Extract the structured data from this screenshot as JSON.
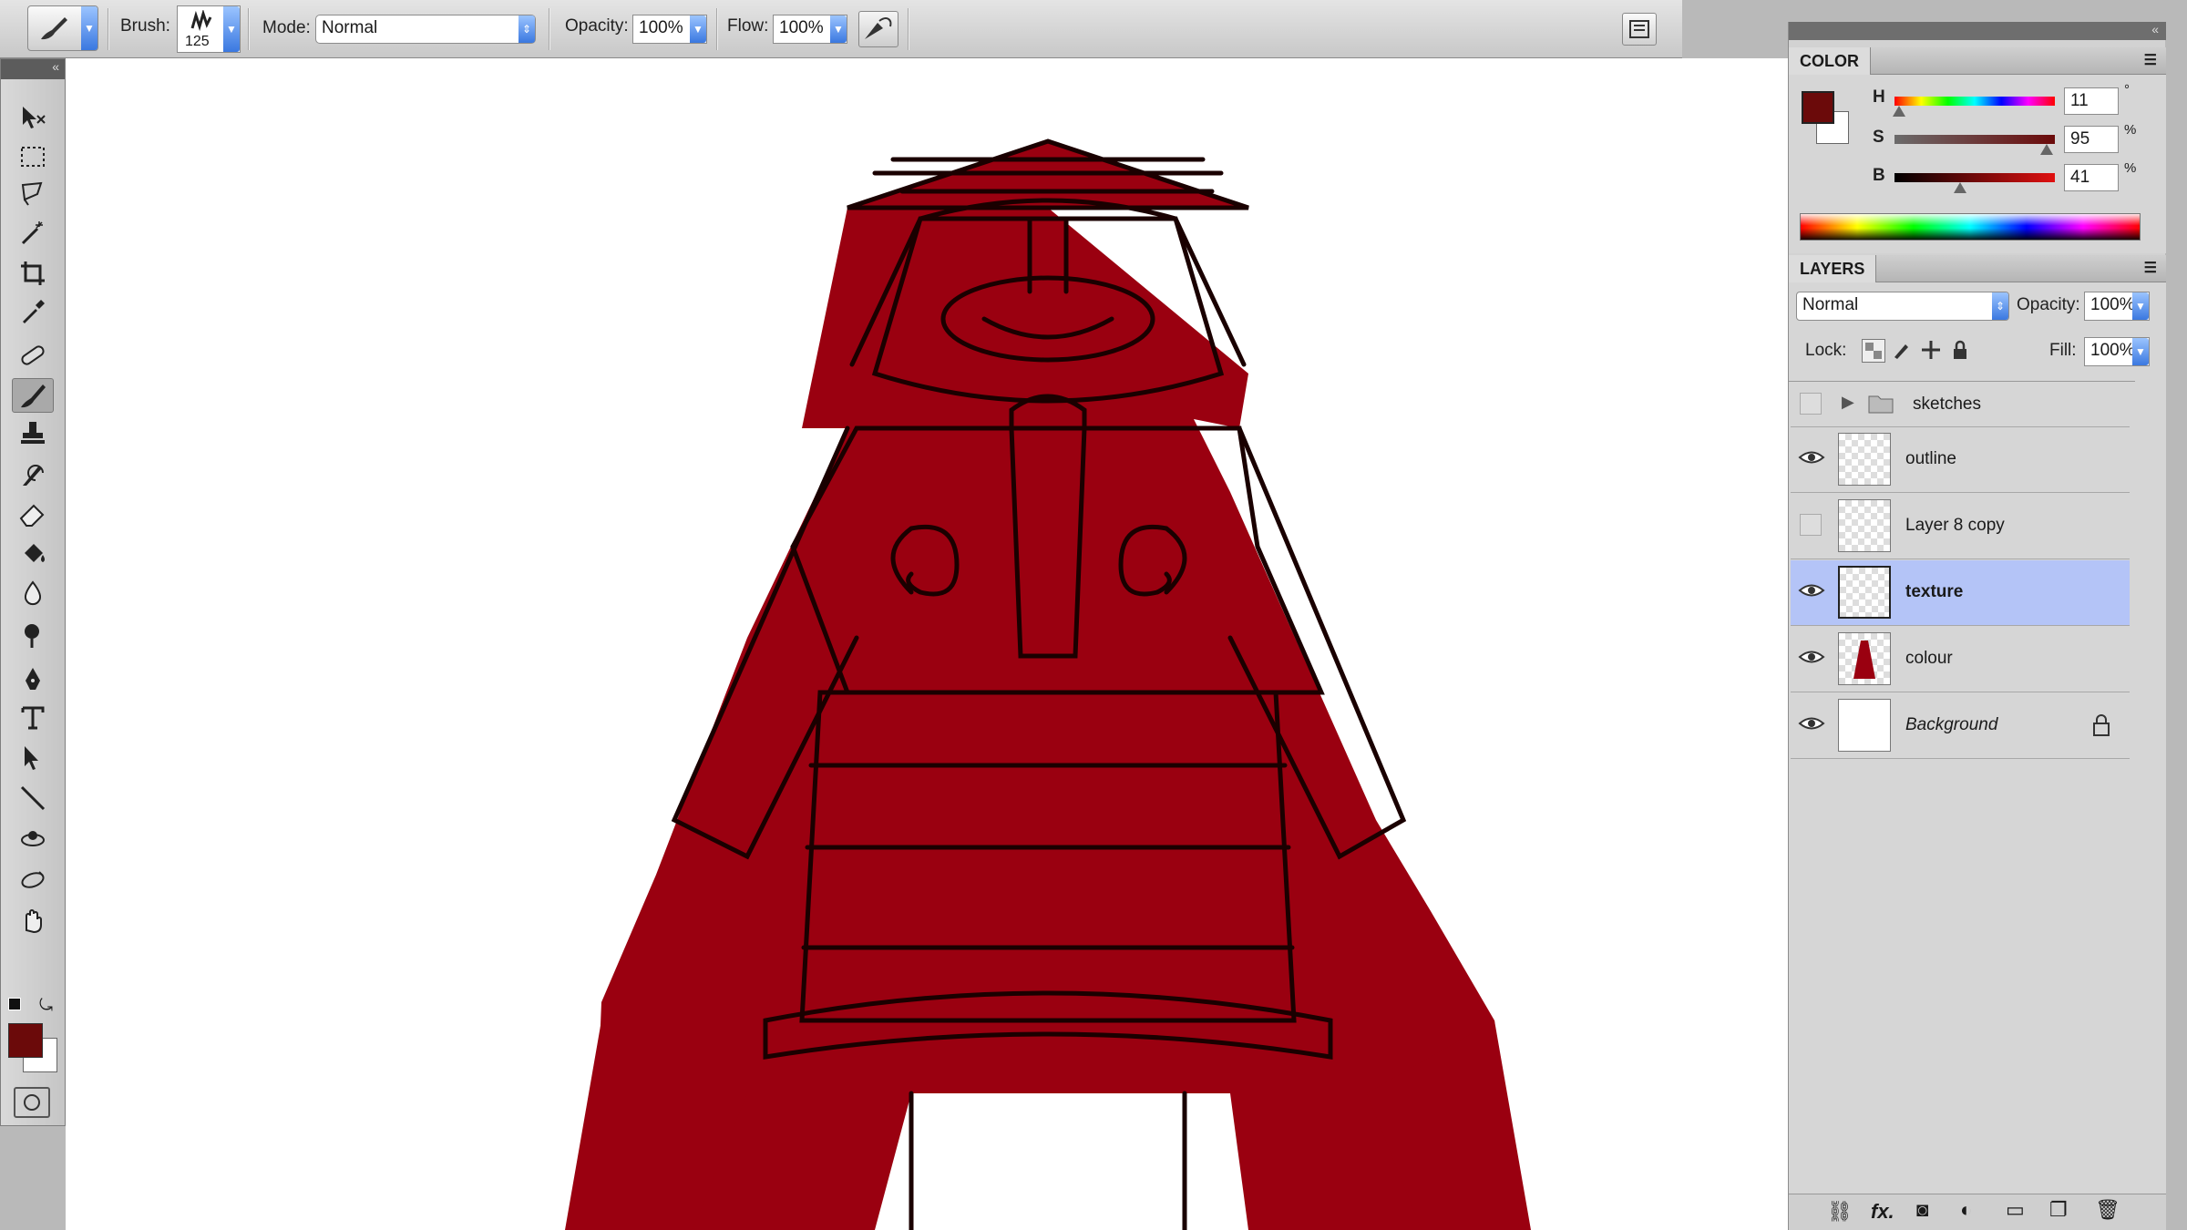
{
  "options_bar": {
    "brush_label": "Brush:",
    "brush_size": "125",
    "mode_label": "Mode:",
    "mode_value": "Normal",
    "opacity_label": "Opacity:",
    "opacity_value": "100%",
    "flow_label": "Flow:",
    "flow_value": "100%"
  },
  "toolbox": {
    "tools": [
      "move-icon",
      "marquee-icon",
      "lasso-icon",
      "magic-wand-icon",
      "crop-icon",
      "eyedropper-icon",
      "healing-icon",
      "brush-icon",
      "stamp-icon",
      "history-brush-icon",
      "eraser-icon",
      "paint-bucket-icon",
      "blur-icon",
      "dodge-icon",
      "pen-icon",
      "type-icon",
      "path-select-icon",
      "line-icon",
      "3d-rotate-icon",
      "3d-orbit-icon",
      "hand-icon",
      "zoom-icon"
    ],
    "active_tool": "brush-icon",
    "foreground_color": "#6b0a0a",
    "background_color": "#ffffff"
  },
  "color_panel": {
    "tab": "COLOR",
    "swatch": "#6b0a0a",
    "h_label": "H",
    "h_value": "11",
    "h_unit": "°",
    "h_fraction": 0.03,
    "s_label": "S",
    "s_value": "95",
    "s_unit": "%",
    "s_fraction": 0.95,
    "b_label": "B",
    "b_value": "41",
    "b_unit": "%",
    "b_fraction": 0.41
  },
  "layers_panel": {
    "tab": "LAYERS",
    "blend_mode": "Normal",
    "opacity_label": "Opacity:",
    "opacity_value": "100%",
    "lock_label": "Lock:",
    "fill_label": "Fill:",
    "fill_value": "100%",
    "group_name": "sketches",
    "layers": [
      {
        "name": "outline",
        "visible": true
      },
      {
        "name": "Layer 8 copy",
        "visible": false
      },
      {
        "name": "texture",
        "visible": true,
        "selected": true
      },
      {
        "name": "colour",
        "visible": true
      },
      {
        "name": "Background",
        "visible": true,
        "locked": true
      }
    ],
    "footer_fx": "fx."
  },
  "artwork": {
    "fill_color": "#9a0010",
    "line_color": "#1a0000"
  }
}
